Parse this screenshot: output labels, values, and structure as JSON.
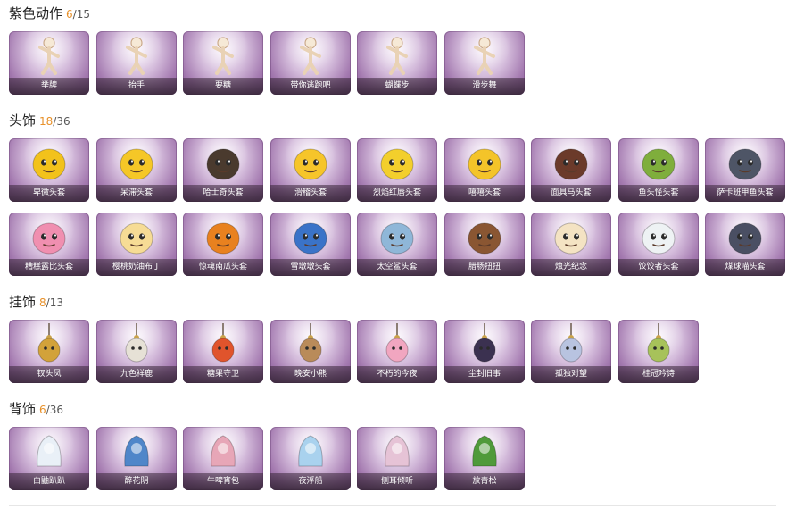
{
  "sections": [
    {
      "id": "purple-actions",
      "name": "紫色动作",
      "owned": "6",
      "total": "/15",
      "items": [
        {
          "label": "举牌",
          "icon": "figure-holding-sign-icon"
        },
        {
          "label": "抬手",
          "icon": "figure-raising-hand-icon"
        },
        {
          "label": "要糖",
          "icon": "figure-asking-candy-icon"
        },
        {
          "label": "带你逃跑吧",
          "icon": "figure-running-icon"
        },
        {
          "label": "蝴蝶步",
          "icon": "figure-butterfly-step-icon"
        },
        {
          "label": "滑步舞",
          "icon": "figure-slide-dance-icon"
        }
      ]
    },
    {
      "id": "headwear",
      "name": "头饰",
      "owned": "18",
      "total": "/36",
      "items": [
        {
          "label": "卑微头套",
          "icon": "worried-face-head-icon",
          "color": "#f2c21b"
        },
        {
          "label": "呆滞头套",
          "icon": "dazed-face-head-icon",
          "color": "#f5c727"
        },
        {
          "label": "哈士奇头套",
          "icon": "husky-head-icon",
          "color": "#4a3a2e"
        },
        {
          "label": "滑稽头套",
          "icon": "funny-face-head-icon",
          "color": "#f6c52a"
        },
        {
          "label": "烈焰红唇头套",
          "icon": "pikachu-lips-head-icon",
          "color": "#f3cf2c"
        },
        {
          "label": "嘻嘻头套",
          "icon": "grin-face-head-icon",
          "color": "#f4c429"
        },
        {
          "label": "面具马头套",
          "icon": "horse-head-icon",
          "color": "#6b3a2a"
        },
        {
          "label": "鱼头怪头套",
          "icon": "fish-monster-head-icon",
          "color": "#7fae3c"
        },
        {
          "label": "萨卡班甲鱼头套",
          "icon": "sacabambaspis-head-icon",
          "color": "#4e5566"
        },
        {
          "label": "糟糕露比头套",
          "icon": "pink-pig-head-icon",
          "color": "#f08fb0"
        },
        {
          "label": "樱桃奶油布丁",
          "icon": "pudding-head-icon",
          "color": "#f6dc95"
        },
        {
          "label": "惊魂南瓜头套",
          "icon": "pumpkin-head-icon",
          "color": "#e8811f"
        },
        {
          "label": "雪墩墩头套",
          "icon": "snow-bear-head-icon",
          "color": "#3a73c8"
        },
        {
          "label": "太空鲨头套",
          "icon": "space-shark-head-icon",
          "color": "#8fb7d8"
        },
        {
          "label": "腊肠扭扭",
          "icon": "dachshund-head-icon",
          "color": "#8a5632"
        },
        {
          "label": "烛光纪念",
          "icon": "candle-head-icon",
          "color": "#f4e3c3"
        },
        {
          "label": "饺饺者头套",
          "icon": "dumpling-head-icon",
          "color": "#eef2f4"
        },
        {
          "label": "煤球喵头套",
          "icon": "black-cat-head-icon",
          "color": "#4a4f63"
        }
      ]
    },
    {
      "id": "pendants",
      "name": "挂饰",
      "owned": "8",
      "total": "/13",
      "items": [
        {
          "label": "钗头凤",
          "icon": "phoenix-hairpin-pendant-icon",
          "color": "#d2a23a"
        },
        {
          "label": "九色祥鹿",
          "icon": "nine-color-deer-pendant-icon",
          "color": "#e6e1d6"
        },
        {
          "label": "糖果守卫",
          "icon": "candy-guard-pendant-icon",
          "color": "#e0542c"
        },
        {
          "label": "晚安小熊",
          "icon": "goodnight-bear-pendant-icon",
          "color": "#b98b5a"
        },
        {
          "label": "不朽的今夜",
          "icon": "immortal-tonight-pendant-icon",
          "color": "#f1a6c0"
        },
        {
          "label": "尘封旧事",
          "icon": "sealed-story-pendant-icon",
          "color": "#3b3150"
        },
        {
          "label": "孤独对望",
          "icon": "lonely-gaze-pendant-icon",
          "color": "#b8c3e0"
        },
        {
          "label": "桂冠吟诗",
          "icon": "laurel-poet-pendant-icon",
          "color": "#a7c25a"
        }
      ]
    },
    {
      "id": "back-accessories",
      "name": "背饰",
      "owned": "6",
      "total": "/36",
      "items": [
        {
          "label": "白鼬趴趴",
          "icon": "ermine-back-icon",
          "color": "#e9f0f7"
        },
        {
          "label": "醉花阴",
          "icon": "flower-umbrella-back-icon",
          "color": "#4f86c9"
        },
        {
          "label": "牛啤宵包",
          "icon": "cow-beer-bag-back-icon",
          "color": "#e7a6b7"
        },
        {
          "label": "夜浮船",
          "icon": "night-boat-back-icon",
          "color": "#a9d2ee"
        },
        {
          "label": "侧耳倾听",
          "icon": "listening-moon-back-icon",
          "color": "#e6c3d6"
        },
        {
          "label": "放青松",
          "icon": "bonsai-pine-back-icon",
          "color": "#4f9a3a"
        }
      ]
    }
  ]
}
